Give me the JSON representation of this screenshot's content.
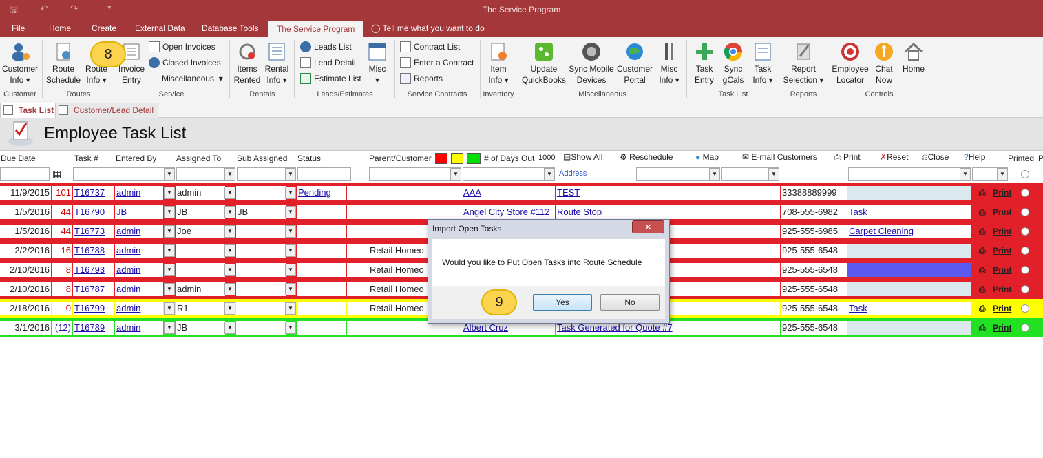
{
  "window": {
    "title": "The Service Program"
  },
  "menu": [
    "File",
    "Home",
    "Create",
    "External Data",
    "Database Tools",
    "The Service Program"
  ],
  "tell_me": "Tell me what you want to do",
  "ribbon": {
    "customer": {
      "btn1": "Customer",
      "btn1b": "Info",
      "label": "Customer"
    },
    "routes": {
      "b1a": "Route",
      "b1b": "Schedule",
      "b2a": "Route",
      "b2b": "Info",
      "label": "Routes"
    },
    "service": {
      "b1a": "Invoice",
      "b1b": "Entry",
      "open": "Open Invoices",
      "closed": "Closed Invoices",
      "misc": "Miscellaneous",
      "label": "Service"
    },
    "rentals": {
      "b1a": "Items",
      "b1b": "Rented",
      "b2a": "Rental",
      "b2b": "Info",
      "label": "Rentals"
    },
    "leads": {
      "l1": "Leads List",
      "l2": "Lead Detail",
      "l3": "Estimate List",
      "misc": "Misc",
      "label": "Leads/Estimates"
    },
    "contracts": {
      "c1": "Contract List",
      "c2": "Enter a Contract",
      "c3": "Reports",
      "label": "Service Contracts"
    },
    "inventory": {
      "b1a": "Item",
      "b1b": "Info",
      "label": "Inventory"
    },
    "miscellaneous": {
      "b1a": "Update",
      "b1b": "QuickBooks",
      "b2a": "Sync Mobile",
      "b2b": "Devices",
      "b3a": "Customer",
      "b3b": "Portal",
      "b4a": "Misc",
      "b4b": "Info",
      "label": "Miscellaneous"
    },
    "tasklist": {
      "b1a": "Task",
      "b1b": "Entry",
      "b2a": "Sync",
      "b2b": "gCals",
      "b3a": "Task",
      "b3b": "Info",
      "label": "Task List"
    },
    "reports": {
      "b1a": "Report",
      "b1b": "Selection",
      "label": "Reports"
    },
    "controls": {
      "b1a": "Employee",
      "b1b": "Locator",
      "b2a": "Chat",
      "b2b": "Now",
      "b3": "Home",
      "label": "Controls"
    }
  },
  "tabs": [
    "Task List",
    "Customer/Lead Detail"
  ],
  "form": {
    "title": "Employee Task List"
  },
  "columns": {
    "due": "Due Date",
    "task": "Task #",
    "entered": "Entered By",
    "assigned": "Assigned To",
    "sub": "Sub Assigned",
    "status": "Status",
    "parent": "Parent/Customer",
    "days": "# of Days Out",
    "days_value": "1000",
    "show_all": "Show All",
    "reschedule": "Reschedule",
    "map": "Map",
    "email": "E-mail Customers",
    "print": "Print",
    "reset": "Reset",
    "close": "Close",
    "help": "Help",
    "printed": "Printed",
    "address": "Address",
    "cut": "P"
  },
  "rows": [
    {
      "due": "11/9/2015",
      "days": "101",
      "task": "T16737",
      "entered": "admin",
      "assigned": "admin",
      "sub": "",
      "status": "Pending",
      "parent": "",
      "customer": "AAA",
      "address": "TEST",
      "phone": "33388889999",
      "tasktype": "",
      "band": "#e2202a",
      "typebg": "#dbe9ee"
    },
    {
      "due": "1/5/2016",
      "days": "44",
      "task": "T16790",
      "entered": "JB",
      "assigned": "JB",
      "sub": "JB",
      "status": "",
      "parent": "",
      "customer": "Angel City Store #112",
      "address": "Route Stop",
      "phone": "708-555-6982",
      "tasktype": "Task",
      "band": "#e2202a",
      "typebg": "#ffffff"
    },
    {
      "due": "1/5/2016",
      "days": "44",
      "task": "T16773",
      "entered": "admin",
      "assigned": "Joe",
      "sub": "",
      "status": "",
      "parent": "",
      "customer": "",
      "address": "",
      "phone": "925-555-6985",
      "tasktype": "Carpet Cleaning",
      "band": "#e2202a",
      "typebg": "#ffffff"
    },
    {
      "due": "2/2/2016",
      "days": "16",
      "task": "T16788",
      "entered": "admin",
      "assigned": "",
      "sub": "",
      "status": "",
      "parent": "Retail Homeo",
      "customer": "",
      "address": "#7",
      "phone": "925-555-6548",
      "tasktype": "",
      "band": "#e2202a",
      "typebg": "#dbe9ee"
    },
    {
      "due": "2/10/2016",
      "days": "8",
      "task": "T16793",
      "entered": "admin",
      "assigned": "",
      "sub": "",
      "status": "",
      "parent": "Retail Homeo",
      "customer": "",
      "address": "",
      "phone": "925-555-6548",
      "tasktype": "",
      "band": "#e2202a",
      "typebg": "#5a5af0"
    },
    {
      "due": "2/10/2016",
      "days": "8",
      "task": "T16787",
      "entered": "admin",
      "assigned": "admin",
      "sub": "",
      "status": "",
      "parent": "Retail Homeo",
      "customer": "",
      "address": "#7",
      "phone": "925-555-6548",
      "tasktype": "",
      "band": "#e2202a",
      "typebg": "#dbe9ee"
    },
    {
      "due": "2/18/2016",
      "days": "0",
      "task": "T16799",
      "entered": "admin",
      "assigned": "R1",
      "sub": "",
      "status": "",
      "parent": "Retail Homeo",
      "customer": "",
      "address": "",
      "phone": "925-555-6548",
      "tasktype": "Task",
      "band": "#ffff00",
      "typebg": "#ffffff"
    },
    {
      "due": "3/1/2016",
      "days": "(12)",
      "task": "T16789",
      "entered": "admin",
      "assigned": "JB",
      "sub": "",
      "status": "",
      "parent": "",
      "customer": "Albert Cruz",
      "address": "Task Generated for Quote #7",
      "phone": "925-555-6548",
      "tasktype": "",
      "band": "#22e022",
      "typebg": "#dbe9ee"
    }
  ],
  "print_label": "Print",
  "dialog": {
    "title": "Import Open Tasks",
    "message": "Would you like to Put Open Tasks into Route Schedule",
    "yes": "Yes",
    "no": "No"
  },
  "badges": {
    "b8": "8",
    "b9": "9"
  },
  "colors": {
    "accent": "#a4373a",
    "red": "#e2202a",
    "yellow": "#ffff00",
    "green": "#22e022"
  }
}
